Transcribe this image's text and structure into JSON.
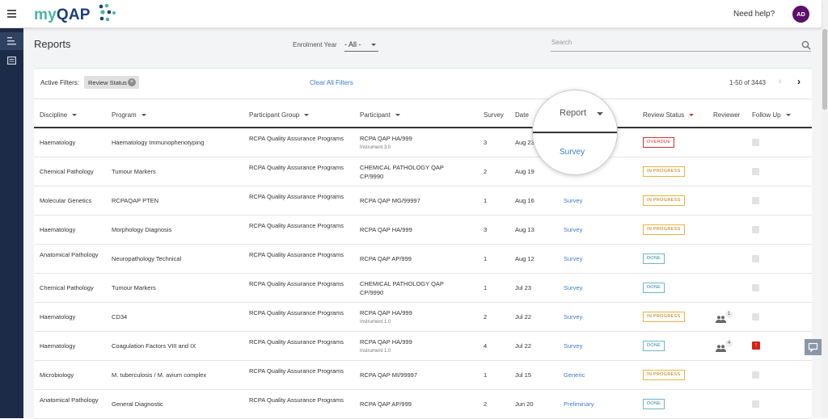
{
  "app": {
    "logo_my": "my",
    "logo_qap": "QAP",
    "help": "Need help?",
    "avatar": "AD"
  },
  "page": {
    "title": "Reports"
  },
  "enrolment": {
    "label": "Enrolment Year",
    "value": "- All -"
  },
  "search": {
    "placeholder": "Search"
  },
  "filters": {
    "label": "Active Filters:",
    "chip": "Review Status",
    "clear": "Clear All Filters"
  },
  "pagination": {
    "range": "1-50 of 3443"
  },
  "columns": {
    "discipline": "Discipline",
    "program": "Program",
    "group": "Participant Group",
    "participant": "Participant",
    "survey": "Survey",
    "date": "Date",
    "report": "Report",
    "review": "Review Status",
    "reviewer": "Reviewer",
    "followup": "Follow Up"
  },
  "magnifier": {
    "header": "Report",
    "value": "Survey"
  },
  "rows": [
    {
      "discipline": "Haematology",
      "program": "Haematology Immunophenotyping",
      "group": "RCPA Quality Assurance Programs",
      "participant": "RCPA QAP HA/999",
      "instrument": "Instrument 3.0",
      "survey": "3",
      "date": "Aug 23",
      "report": "",
      "status": "OVERDUE",
      "reviewer_count": "",
      "followup": false
    },
    {
      "discipline": "Chemical Pathology",
      "program": "Tumour Markers",
      "group": "RCPA Quality Assurance Programs",
      "participant": "CHEMICAL PATHOLOGY QAP CP/9990",
      "instrument": "",
      "survey": "2",
      "date": "Aug 19",
      "report": "Survey",
      "status": "IN PROGRESS",
      "reviewer_count": "",
      "followup": false
    },
    {
      "discipline": "Molecular Genetics",
      "program": "RCPAQAP PTEN",
      "group": "RCPA Quality Assurance Programs",
      "participant": "RCPA QAP MG/99997",
      "instrument": "",
      "survey": "1",
      "date": "Aug 16",
      "report": "Survey",
      "status": "IN PROGRESS",
      "reviewer_count": "",
      "followup": false
    },
    {
      "discipline": "Haematology",
      "program": "Morphology Diagnosis",
      "group": "RCPA Quality Assurance Programs",
      "participant": "RCPA QAP HA/999",
      "instrument": "",
      "survey": "3",
      "date": "Aug 13",
      "report": "Survey",
      "status": "IN PROGRESS",
      "reviewer_count": "",
      "followup": false
    },
    {
      "discipline": "Anatomical Pathology",
      "program": "Neuropathology Technical",
      "group": "RCPA Quality Assurance Programs",
      "participant": "RCPA QAP AP/999",
      "instrument": "",
      "survey": "1",
      "date": "Aug 12",
      "report": "Survey",
      "status": "DONE",
      "reviewer_count": "",
      "followup": false
    },
    {
      "discipline": "Chemical Pathology",
      "program": "Tumour Markers",
      "group": "RCPA Quality Assurance Programs",
      "participant": "CHEMICAL PATHOLOGY QAP CP/9990",
      "instrument": "",
      "survey": "1",
      "date": "Jul 23",
      "report": "Survey",
      "status": "DONE",
      "reviewer_count": "",
      "followup": false
    },
    {
      "discipline": "Haematology",
      "program": "CD34",
      "group": "RCPA Quality Assurance Programs",
      "participant": "RCPA QAP HA/999",
      "instrument": "Instrument 1.0",
      "survey": "2",
      "date": "Jul 22",
      "report": "Survey",
      "status": "IN PROGRESS",
      "reviewer_count": "1",
      "followup": false
    },
    {
      "discipline": "Haematology",
      "program": "Coagulation Factors VIII and IX",
      "group": "RCPA Quality Assurance Programs",
      "participant": "RCPA QAP HA/999",
      "instrument": "Instrument 1.0",
      "survey": "4",
      "date": "Jul 22",
      "report": "Survey",
      "status": "DONE",
      "reviewer_count": "4",
      "followup": true
    },
    {
      "discipline": "Microbiology",
      "program": "M. tuberculosis / M. avium complex",
      "group": "RCPA Quality Assurance Programs",
      "participant": "RCPA QAP MI/99997",
      "instrument": "",
      "survey": "1",
      "date": "Jul 15",
      "report": "Generic",
      "status": "IN PROGRESS",
      "reviewer_count": "",
      "followup": false
    },
    {
      "discipline": "Anatomical Pathology",
      "program": "General Diagnostic",
      "group": "RCPA Quality Assurance Programs",
      "participant": "RCPA QAP AP/999",
      "instrument": "",
      "survey": "2",
      "date": "Jun 20",
      "report": "Preliminary",
      "status": "DONE",
      "reviewer_count": "",
      "followup": false
    }
  ]
}
